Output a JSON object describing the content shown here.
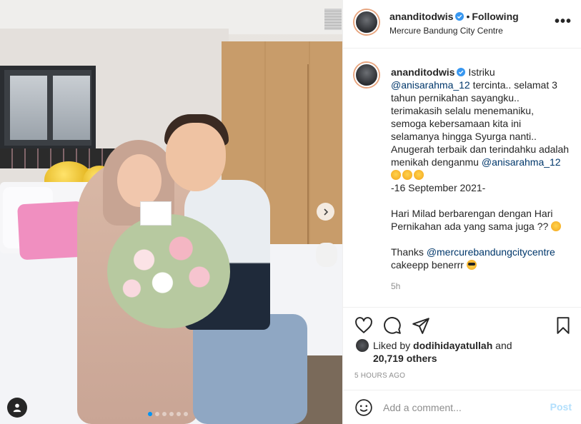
{
  "post": {
    "carousel_dots": 6,
    "active_dot": 0
  },
  "header": {
    "username": "ananditodwis",
    "separator": "•",
    "follow_status": "Following",
    "location": "Mercure Bandung City Centre",
    "more_label": "•••"
  },
  "caption": {
    "username": "ananditodwis",
    "part1": " Istriku ",
    "mention1": "@anisarahma_12",
    "part2": " tercinta.. selamat 3 tahun pernikahan sayangku.. terimakasih selalu menemaniku, semoga kebersamaan kita ini selamanya hingga Syurga nanti.. Anugerah terbaik dan terindahku adalah menikah denganmu ",
    "mention2": "@anisarahma_12",
    "date_line": "-16 September 2021-",
    "part3": "Hari Milad berbarengan dengan Hari Pernikahan ada yang sama juga ?? ",
    "part4": "Thanks ",
    "mention3": "@mercurebandungcitycentre",
    "part5": " cakeepp benerrr ",
    "time": "5h"
  },
  "likes": {
    "prefix": "Liked by ",
    "liker": "dodihidayatullah",
    "connector": " and",
    "others": "20,719 others"
  },
  "posted_ago": "5 HOURS AGO",
  "comment": {
    "placeholder": "Add a comment...",
    "post_label": "Post"
  },
  "icons": {
    "verified": "verified-badge-icon",
    "like": "heart-icon",
    "comment": "comment-bubble-icon",
    "share": "paper-plane-icon",
    "save": "bookmark-icon",
    "emoji": "smiley-icon",
    "tag": "user-tag-icon",
    "next": "chevron-right-icon"
  },
  "colors": {
    "verified_blue": "#3897f0",
    "mention_blue": "#00376b",
    "post_disabled": "#b2dffc",
    "muted": "#8e8e8e",
    "active_dot": "#0095f6"
  }
}
